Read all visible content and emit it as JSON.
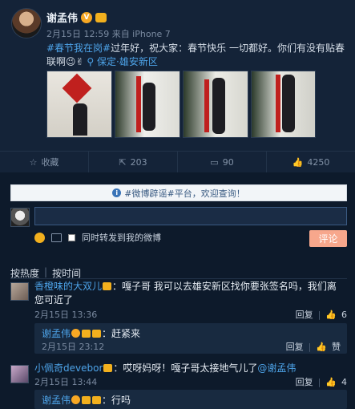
{
  "post": {
    "author": "谢孟伟",
    "meta": "2月15日 12:59 来自 iPhone 7",
    "hashtag": "#春节我在岗#",
    "body": "过年好，祝大家：春节快乐 一切都好。你们有没有贴春联啊😉✌",
    "location": "保定·雄安新区",
    "photos": [
      "photo-1",
      "photo-2",
      "photo-3",
      "photo-4"
    ],
    "actions": {
      "favorite": "收藏",
      "forward": "203",
      "comment": "90",
      "like": "4250"
    }
  },
  "comments_panel": {
    "notice": "#微博辟谣#平台，欢迎查询！",
    "input_placeholder": "",
    "repost_label": "同时转发到我的微博",
    "submit_label": "评论",
    "sort_hot": "按热度",
    "sort_time": "按时间"
  },
  "comments": [
    {
      "user": "香橙味的大双儿",
      "text": "：嘎子哥 我可以去雄安新区找你要张签名吗，我们离您可近了",
      "time": "2月15日 13:36",
      "reply_label": "回复",
      "likes": "6",
      "reply": {
        "user": "谢孟伟",
        "text": "：赶紧来",
        "time": "2月15日 23:12",
        "reply_label": "回复",
        "like_label": "赞"
      }
    },
    {
      "user": "小佩奇devebor",
      "text": "：哎呀妈呀！嘎子哥太接地气儿了",
      "mention": "@谢孟伟",
      "time": "2月15日 13:44",
      "reply_label": "回复",
      "likes": "4",
      "reply": {
        "user": "谢孟伟",
        "text": "：行吗"
      }
    }
  ]
}
